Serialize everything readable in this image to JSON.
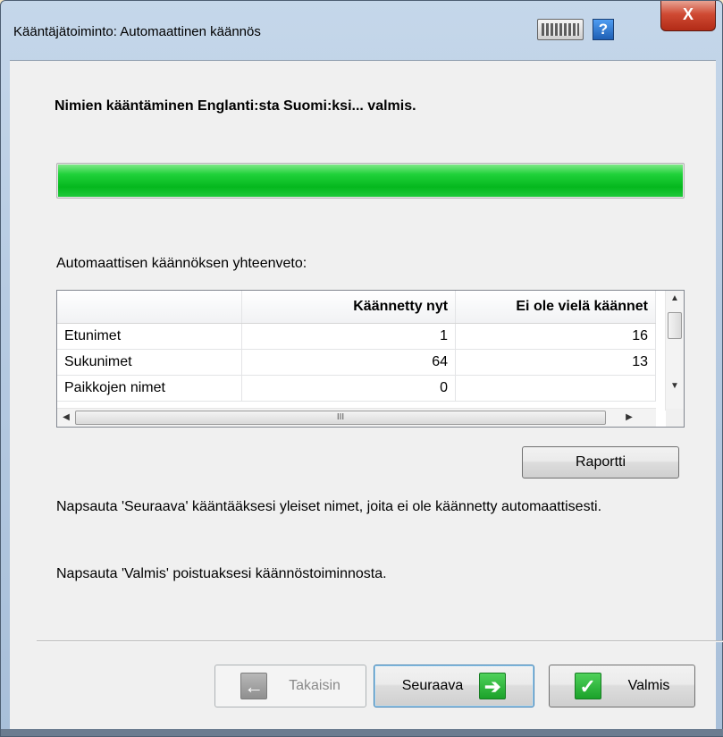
{
  "window": {
    "title": "Kääntäjätoiminto: Automaattinen käännös",
    "help_label": "?",
    "close_label": "X"
  },
  "main": {
    "heading": "Nimien kääntäminen Englanti:sta Suomi:ksi... valmis.",
    "progress_percent": 100,
    "summary_label": "Automaattisen käännöksen yhteenveto:",
    "table": {
      "columns": [
        "",
        "Käännetty nyt",
        "Ei ole vielä käännet"
      ],
      "rows": [
        [
          "Etunimet",
          "1",
          "16"
        ],
        [
          "Sukunimet",
          "64",
          "13"
        ],
        [
          "Paikkojen nimet",
          "0",
          ""
        ]
      ],
      "hscroll_glyph": "III"
    },
    "report_button": "Raportti",
    "info_next": "Napsauta 'Seuraava' kääntääksesi yleiset nimet, joita ei ole käännetty automaattisesti.",
    "info_done": "Napsauta 'Valmis' poistuaksesi käännöstoiminnosta."
  },
  "footer": {
    "back_label": "Takaisin",
    "next_label": "Seuraava",
    "done_label": "Valmis"
  },
  "colors": {
    "progress": "#05b81e",
    "close": "#cf4a33"
  }
}
